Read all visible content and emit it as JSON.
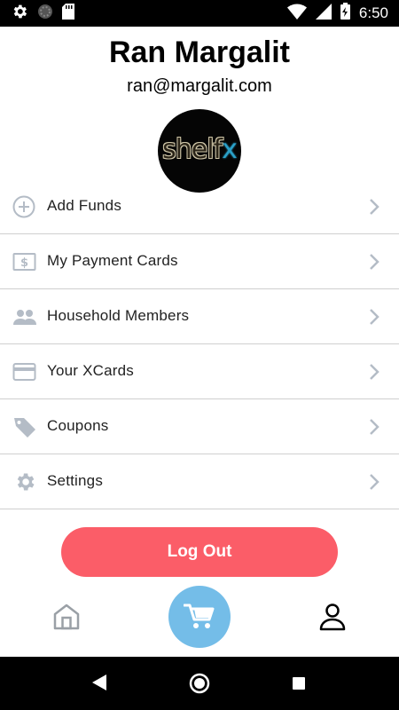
{
  "status_bar": {
    "time": "6:50",
    "icons_left": [
      "settings-icon",
      "sync-icon",
      "sd-card-icon"
    ],
    "icons_right": [
      "wifi-icon",
      "cellular-signal-icon",
      "battery-charging-icon"
    ]
  },
  "profile": {
    "name": "Ran Margalit",
    "email": "ran@margalit.com",
    "avatar_logo": "shelfx"
  },
  "menu": {
    "items": [
      {
        "label": "Add Funds",
        "icon": "add-circle-icon"
      },
      {
        "label": "My Payment Cards",
        "icon": "dollar-card-icon"
      },
      {
        "label": "Household Members",
        "icon": "people-icon"
      },
      {
        "label": "Your XCards",
        "icon": "credit-card-icon"
      },
      {
        "label": "Coupons",
        "icon": "tag-icon"
      },
      {
        "label": "Settings",
        "icon": "gear-icon"
      }
    ]
  },
  "logout": {
    "label": "Log Out"
  },
  "bottom_nav": {
    "items": [
      "home-icon",
      "cart-icon",
      "profile-icon"
    ],
    "active": "profile"
  },
  "colors": {
    "accent_red": "#fb5d68",
    "cart_blue": "#74bde8",
    "icon_gray": "#b4bcc6",
    "divider": "#cfcfcf"
  }
}
